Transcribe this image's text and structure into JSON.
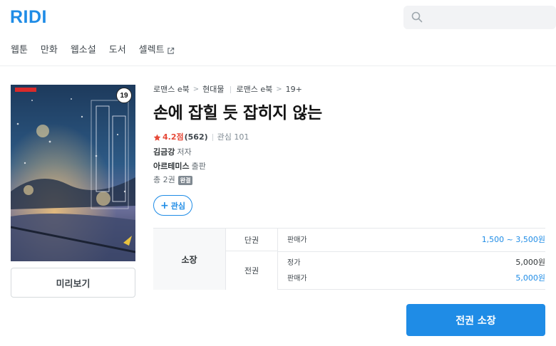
{
  "brand": {
    "logo": "RIDI",
    "color": "#1f8ce6"
  },
  "search": {
    "placeholder": "",
    "icon": "search-icon"
  },
  "nav": {
    "items": [
      {
        "label": "웹툰"
      },
      {
        "label": "만화"
      },
      {
        "label": "웹소설"
      },
      {
        "label": "도서"
      },
      {
        "label": "셀렉트",
        "icon": "external-link-icon"
      }
    ]
  },
  "book": {
    "cover_age_badge": "19",
    "breadcrumb": {
      "group1": [
        "로맨스 e북",
        "현대물"
      ],
      "group2": [
        "로맨스 e북",
        "19+"
      ],
      "separator": ">"
    },
    "title": "손에 잡힐 듯 잡히지 않는",
    "rating": "4.2점",
    "rating_count": "(562)",
    "interest": "관심 101",
    "author": {
      "name": "김금강",
      "role": "저자"
    },
    "publisher": {
      "name": "아르테미스",
      "role": "출판"
    },
    "volumes": {
      "text": "총 2권",
      "badge": "완결"
    },
    "wish_button": {
      "plus": "+",
      "label": "관심"
    },
    "preview_button": "미리보기"
  },
  "price_table": {
    "own_label": "소장",
    "single": {
      "type": "단권",
      "label": "판매가",
      "value": "1,500 ~ 3,500원"
    },
    "full": {
      "type": "전권",
      "list_label": "정가",
      "list_value": "5,000원",
      "sale_label": "판매가",
      "sale_value": "5,000원"
    }
  },
  "buy_button": "전권 소장",
  "colors": {
    "accent": "#1f8ce6",
    "rating": "#e64938"
  }
}
